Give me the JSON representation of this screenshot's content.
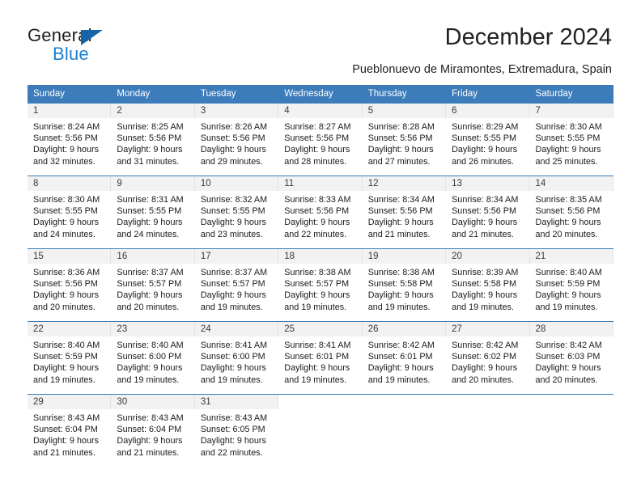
{
  "brand": {
    "name_top": "General",
    "name_bottom": "Blue",
    "accent_color": "#1c7fd4",
    "triangle_color": "#1565a8"
  },
  "header": {
    "title": "December 2024",
    "subtitle": "Pueblonuevo de Miramontes, Extremadura, Spain"
  },
  "calendar": {
    "header_color": "#3c7cbb",
    "weekday_headers": [
      "Sunday",
      "Monday",
      "Tuesday",
      "Wednesday",
      "Thursday",
      "Friday",
      "Saturday"
    ],
    "weeks": [
      [
        {
          "day": "1",
          "sunrise": "Sunrise: 8:24 AM",
          "sunset": "Sunset: 5:56 PM",
          "daylight1": "Daylight: 9 hours",
          "daylight2": "and 32 minutes."
        },
        {
          "day": "2",
          "sunrise": "Sunrise: 8:25 AM",
          "sunset": "Sunset: 5:56 PM",
          "daylight1": "Daylight: 9 hours",
          "daylight2": "and 31 minutes."
        },
        {
          "day": "3",
          "sunrise": "Sunrise: 8:26 AM",
          "sunset": "Sunset: 5:56 PM",
          "daylight1": "Daylight: 9 hours",
          "daylight2": "and 29 minutes."
        },
        {
          "day": "4",
          "sunrise": "Sunrise: 8:27 AM",
          "sunset": "Sunset: 5:56 PM",
          "daylight1": "Daylight: 9 hours",
          "daylight2": "and 28 minutes."
        },
        {
          "day": "5",
          "sunrise": "Sunrise: 8:28 AM",
          "sunset": "Sunset: 5:56 PM",
          "daylight1": "Daylight: 9 hours",
          "daylight2": "and 27 minutes."
        },
        {
          "day": "6",
          "sunrise": "Sunrise: 8:29 AM",
          "sunset": "Sunset: 5:55 PM",
          "daylight1": "Daylight: 9 hours",
          "daylight2": "and 26 minutes."
        },
        {
          "day": "7",
          "sunrise": "Sunrise: 8:30 AM",
          "sunset": "Sunset: 5:55 PM",
          "daylight1": "Daylight: 9 hours",
          "daylight2": "and 25 minutes."
        }
      ],
      [
        {
          "day": "8",
          "sunrise": "Sunrise: 8:30 AM",
          "sunset": "Sunset: 5:55 PM",
          "daylight1": "Daylight: 9 hours",
          "daylight2": "and 24 minutes."
        },
        {
          "day": "9",
          "sunrise": "Sunrise: 8:31 AM",
          "sunset": "Sunset: 5:55 PM",
          "daylight1": "Daylight: 9 hours",
          "daylight2": "and 24 minutes."
        },
        {
          "day": "10",
          "sunrise": "Sunrise: 8:32 AM",
          "sunset": "Sunset: 5:55 PM",
          "daylight1": "Daylight: 9 hours",
          "daylight2": "and 23 minutes."
        },
        {
          "day": "11",
          "sunrise": "Sunrise: 8:33 AM",
          "sunset": "Sunset: 5:56 PM",
          "daylight1": "Daylight: 9 hours",
          "daylight2": "and 22 minutes."
        },
        {
          "day": "12",
          "sunrise": "Sunrise: 8:34 AM",
          "sunset": "Sunset: 5:56 PM",
          "daylight1": "Daylight: 9 hours",
          "daylight2": "and 21 minutes."
        },
        {
          "day": "13",
          "sunrise": "Sunrise: 8:34 AM",
          "sunset": "Sunset: 5:56 PM",
          "daylight1": "Daylight: 9 hours",
          "daylight2": "and 21 minutes."
        },
        {
          "day": "14",
          "sunrise": "Sunrise: 8:35 AM",
          "sunset": "Sunset: 5:56 PM",
          "daylight1": "Daylight: 9 hours",
          "daylight2": "and 20 minutes."
        }
      ],
      [
        {
          "day": "15",
          "sunrise": "Sunrise: 8:36 AM",
          "sunset": "Sunset: 5:56 PM",
          "daylight1": "Daylight: 9 hours",
          "daylight2": "and 20 minutes."
        },
        {
          "day": "16",
          "sunrise": "Sunrise: 8:37 AM",
          "sunset": "Sunset: 5:57 PM",
          "daylight1": "Daylight: 9 hours",
          "daylight2": "and 20 minutes."
        },
        {
          "day": "17",
          "sunrise": "Sunrise: 8:37 AM",
          "sunset": "Sunset: 5:57 PM",
          "daylight1": "Daylight: 9 hours",
          "daylight2": "and 19 minutes."
        },
        {
          "day": "18",
          "sunrise": "Sunrise: 8:38 AM",
          "sunset": "Sunset: 5:57 PM",
          "daylight1": "Daylight: 9 hours",
          "daylight2": "and 19 minutes."
        },
        {
          "day": "19",
          "sunrise": "Sunrise: 8:38 AM",
          "sunset": "Sunset: 5:58 PM",
          "daylight1": "Daylight: 9 hours",
          "daylight2": "and 19 minutes."
        },
        {
          "day": "20",
          "sunrise": "Sunrise: 8:39 AM",
          "sunset": "Sunset: 5:58 PM",
          "daylight1": "Daylight: 9 hours",
          "daylight2": "and 19 minutes."
        },
        {
          "day": "21",
          "sunrise": "Sunrise: 8:40 AM",
          "sunset": "Sunset: 5:59 PM",
          "daylight1": "Daylight: 9 hours",
          "daylight2": "and 19 minutes."
        }
      ],
      [
        {
          "day": "22",
          "sunrise": "Sunrise: 8:40 AM",
          "sunset": "Sunset: 5:59 PM",
          "daylight1": "Daylight: 9 hours",
          "daylight2": "and 19 minutes."
        },
        {
          "day": "23",
          "sunrise": "Sunrise: 8:40 AM",
          "sunset": "Sunset: 6:00 PM",
          "daylight1": "Daylight: 9 hours",
          "daylight2": "and 19 minutes."
        },
        {
          "day": "24",
          "sunrise": "Sunrise: 8:41 AM",
          "sunset": "Sunset: 6:00 PM",
          "daylight1": "Daylight: 9 hours",
          "daylight2": "and 19 minutes."
        },
        {
          "day": "25",
          "sunrise": "Sunrise: 8:41 AM",
          "sunset": "Sunset: 6:01 PM",
          "daylight1": "Daylight: 9 hours",
          "daylight2": "and 19 minutes."
        },
        {
          "day": "26",
          "sunrise": "Sunrise: 8:42 AM",
          "sunset": "Sunset: 6:01 PM",
          "daylight1": "Daylight: 9 hours",
          "daylight2": "and 19 minutes."
        },
        {
          "day": "27",
          "sunrise": "Sunrise: 8:42 AM",
          "sunset": "Sunset: 6:02 PM",
          "daylight1": "Daylight: 9 hours",
          "daylight2": "and 20 minutes."
        },
        {
          "day": "28",
          "sunrise": "Sunrise: 8:42 AM",
          "sunset": "Sunset: 6:03 PM",
          "daylight1": "Daylight: 9 hours",
          "daylight2": "and 20 minutes."
        }
      ],
      [
        {
          "day": "29",
          "sunrise": "Sunrise: 8:43 AM",
          "sunset": "Sunset: 6:04 PM",
          "daylight1": "Daylight: 9 hours",
          "daylight2": "and 21 minutes."
        },
        {
          "day": "30",
          "sunrise": "Sunrise: 8:43 AM",
          "sunset": "Sunset: 6:04 PM",
          "daylight1": "Daylight: 9 hours",
          "daylight2": "and 21 minutes."
        },
        {
          "day": "31",
          "sunrise": "Sunrise: 8:43 AM",
          "sunset": "Sunset: 6:05 PM",
          "daylight1": "Daylight: 9 hours",
          "daylight2": "and 22 minutes."
        },
        {
          "day": "",
          "sunrise": "",
          "sunset": "",
          "daylight1": "",
          "daylight2": ""
        },
        {
          "day": "",
          "sunrise": "",
          "sunset": "",
          "daylight1": "",
          "daylight2": ""
        },
        {
          "day": "",
          "sunrise": "",
          "sunset": "",
          "daylight1": "",
          "daylight2": ""
        },
        {
          "day": "",
          "sunrise": "",
          "sunset": "",
          "daylight1": "",
          "daylight2": ""
        }
      ]
    ]
  }
}
